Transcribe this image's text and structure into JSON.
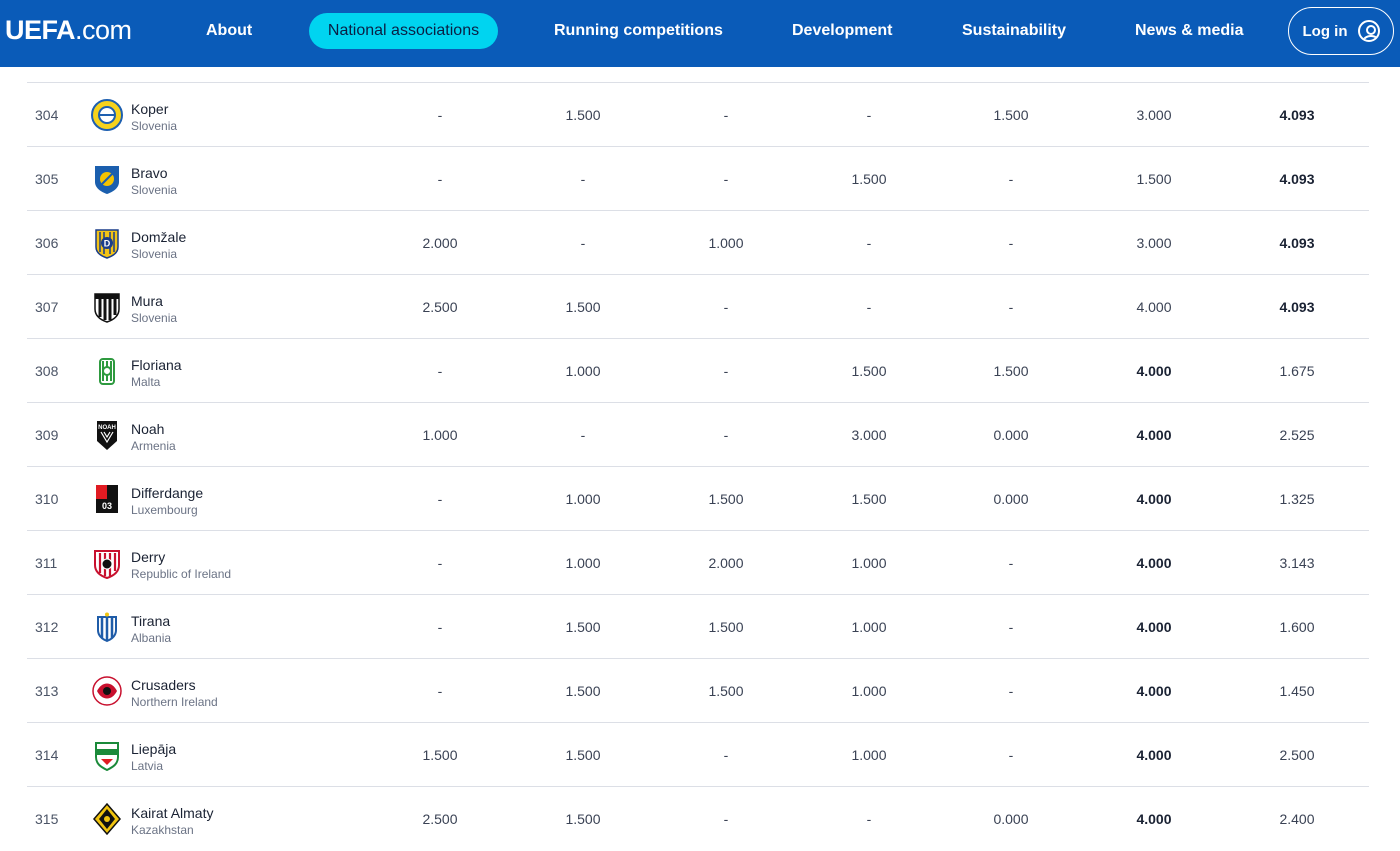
{
  "header": {
    "logo_bold": "UEFA",
    "logo_light": ".com",
    "nav": [
      "About",
      "National associations",
      "Running competitions",
      "Development",
      "Sustainability",
      "News & media"
    ],
    "active_nav": "National associations",
    "login_label": "Log in",
    "colors": {
      "bar": "#0a5bb8",
      "active_pill": "#00d4f0"
    }
  },
  "rows": [
    {
      "rank": "304",
      "club": "Koper",
      "country": "Slovenia",
      "crest": "koper-crest-icon",
      "v": [
        "-",
        "1.500",
        "-",
        "-",
        "1.500",
        "3.000",
        "4.093"
      ],
      "bold_col": 6
    },
    {
      "rank": "305",
      "club": "Bravo",
      "country": "Slovenia",
      "crest": "bravo-crest-icon",
      "v": [
        "-",
        "-",
        "-",
        "1.500",
        "-",
        "1.500",
        "4.093"
      ],
      "bold_col": 6
    },
    {
      "rank": "306",
      "club": "Domžale",
      "country": "Slovenia",
      "crest": "domzale-crest-icon",
      "v": [
        "2.000",
        "-",
        "1.000",
        "-",
        "-",
        "3.000",
        "4.093"
      ],
      "bold_col": 6
    },
    {
      "rank": "307",
      "club": "Mura",
      "country": "Slovenia",
      "crest": "mura-crest-icon",
      "v": [
        "2.500",
        "1.500",
        "-",
        "-",
        "-",
        "4.000",
        "4.093"
      ],
      "bold_col": 6
    },
    {
      "rank": "308",
      "club": "Floriana",
      "country": "Malta",
      "crest": "floriana-crest-icon",
      "v": [
        "-",
        "1.000",
        "-",
        "1.500",
        "1.500",
        "4.000",
        "1.675"
      ],
      "bold_col": 5
    },
    {
      "rank": "309",
      "club": "Noah",
      "country": "Armenia",
      "crest": "noah-crest-icon",
      "v": [
        "1.000",
        "-",
        "-",
        "3.000",
        "0.000",
        "4.000",
        "2.525"
      ],
      "bold_col": 5
    },
    {
      "rank": "310",
      "club": "Differdange",
      "country": "Luxembourg",
      "crest": "differdange-crest-icon",
      "v": [
        "-",
        "1.000",
        "1.500",
        "1.500",
        "0.000",
        "4.000",
        "1.325"
      ],
      "bold_col": 5
    },
    {
      "rank": "311",
      "club": "Derry",
      "country": "Republic of Ireland",
      "crest": "derry-crest-icon",
      "v": [
        "-",
        "1.000",
        "2.000",
        "1.000",
        "-",
        "4.000",
        "3.143"
      ],
      "bold_col": 5
    },
    {
      "rank": "312",
      "club": "Tirana",
      "country": "Albania",
      "crest": "tirana-crest-icon",
      "v": [
        "-",
        "1.500",
        "1.500",
        "1.000",
        "-",
        "4.000",
        "1.600"
      ],
      "bold_col": 5
    },
    {
      "rank": "313",
      "club": "Crusaders",
      "country": "Northern Ireland",
      "crest": "crusaders-crest-icon",
      "v": [
        "-",
        "1.500",
        "1.500",
        "1.000",
        "-",
        "4.000",
        "1.450"
      ],
      "bold_col": 5
    },
    {
      "rank": "314",
      "club": "Liepāja",
      "country": "Latvia",
      "crest": "liepaja-crest-icon",
      "v": [
        "1.500",
        "1.500",
        "-",
        "1.000",
        "-",
        "4.000",
        "2.500"
      ],
      "bold_col": 5
    },
    {
      "rank": "315",
      "club": "Kairat Almaty",
      "country": "Kazakhstan",
      "crest": "kairat-crest-icon",
      "v": [
        "2.500",
        "1.500",
        "-",
        "-",
        "0.000",
        "4.000",
        "2.400"
      ],
      "bold_col": 5
    }
  ]
}
